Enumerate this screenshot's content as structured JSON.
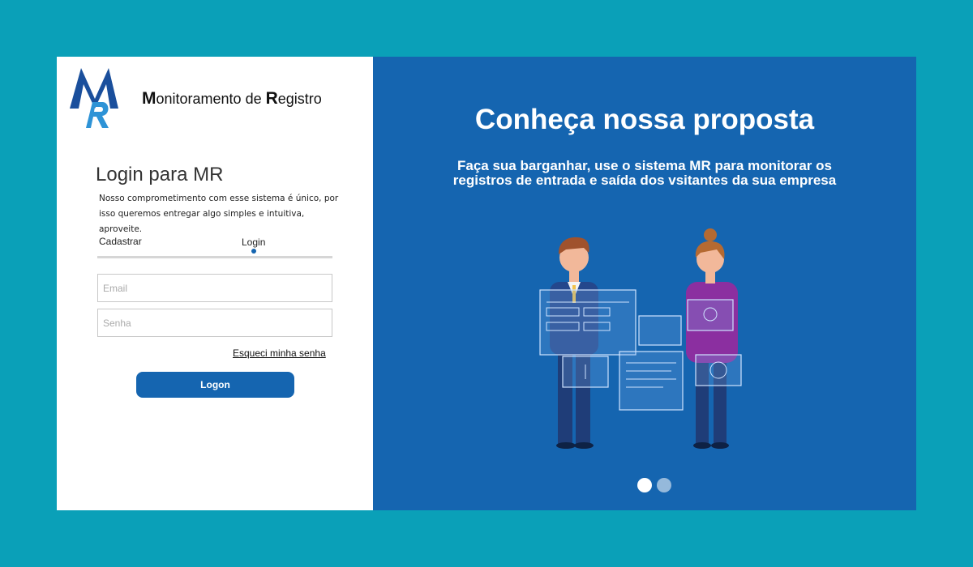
{
  "brand": {
    "name_M": "M",
    "name_rest1": "onitoramento de ",
    "name_R": "R",
    "name_rest2": "egistro",
    "logo_letters": "MR"
  },
  "login": {
    "title": "Login para MR",
    "intro": "Nosso comprometimento com esse sistema é único, por isso queremos entregar algo simples e intuitiva, aproveite.",
    "tabs": [
      "Cadastrar",
      "Login"
    ],
    "active_tab": "Login",
    "email_placeholder": "Email",
    "password_placeholder": "Senha",
    "forgot_label": "Esqueci minha senha",
    "submit_label": "Logon"
  },
  "promo": {
    "headline": "Conheça nossa proposta",
    "subtitle": "Faça sua barganhar, use o sistema MR para monitorar os registros de entrada e saída dos vsitantes da sua empresa",
    "carousel_pages": 2,
    "carousel_active": 1
  },
  "colors": {
    "page_bg": "#0aa0b8",
    "accent": "#1565b0",
    "panel_bg": "#ffffff"
  }
}
